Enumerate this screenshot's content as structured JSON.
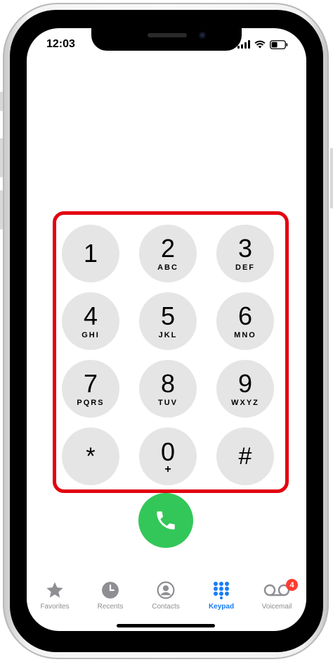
{
  "status_bar": {
    "time": "12:03",
    "icons": [
      "cellular-signal-icon",
      "wifi-icon",
      "battery-icon"
    ]
  },
  "keypad": {
    "keys": [
      {
        "digit": "1",
        "letters": ""
      },
      {
        "digit": "2",
        "letters": "ABC"
      },
      {
        "digit": "3",
        "letters": "DEF"
      },
      {
        "digit": "4",
        "letters": "GHI"
      },
      {
        "digit": "5",
        "letters": "JKL"
      },
      {
        "digit": "6",
        "letters": "MNO"
      },
      {
        "digit": "7",
        "letters": "PQRS"
      },
      {
        "digit": "8",
        "letters": "TUV"
      },
      {
        "digit": "9",
        "letters": "WXYZ"
      },
      {
        "digit": "*",
        "letters": ""
      },
      {
        "digit": "0",
        "letters": "+"
      },
      {
        "digit": "#",
        "letters": ""
      }
    ],
    "highlight_color": "#e3000f",
    "key_color": "#e5e5e5"
  },
  "call_button": {
    "icon": "phone-icon",
    "color": "#33c759"
  },
  "tabbar": {
    "tabs": [
      {
        "label": "Favorites",
        "icon": "star-icon",
        "active": false
      },
      {
        "label": "Recents",
        "icon": "clock-icon",
        "active": false
      },
      {
        "label": "Contacts",
        "icon": "person-circle-icon",
        "active": false
      },
      {
        "label": "Keypad",
        "icon": "keypad-grid-icon",
        "active": true
      },
      {
        "label": "Voicemail",
        "icon": "voicemail-icon",
        "active": false,
        "badge": "4"
      }
    ],
    "active_color": "#1a7cf5",
    "inactive_color": "#8e8e93"
  }
}
